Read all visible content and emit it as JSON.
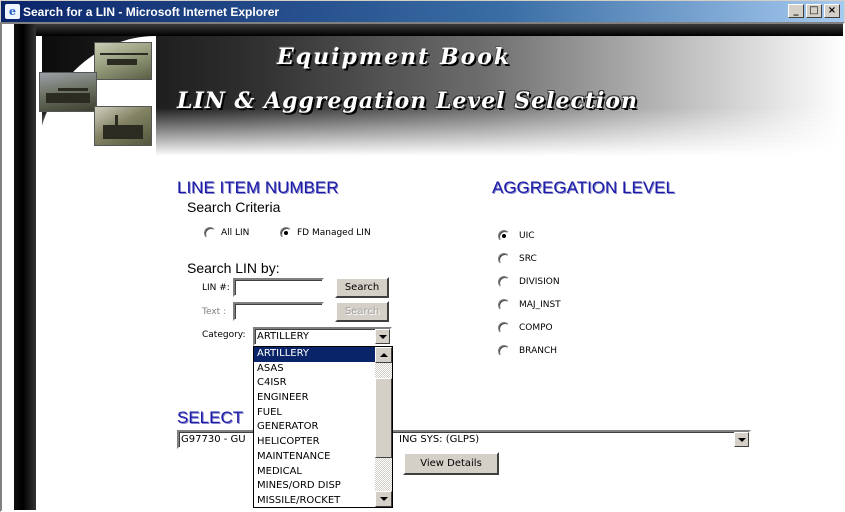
{
  "window": {
    "title": "Search for a LIN - Microsoft Internet Explorer",
    "min_label": "_",
    "max_label": "□",
    "close_label": "×"
  },
  "header": {
    "title": "Equipment Book",
    "subtitle": "LIN & Aggregation Level Selection"
  },
  "lin": {
    "section_title": "LINE ITEM NUMBER",
    "criteria_label": "Search Criteria",
    "criteria_options": [
      {
        "label": "All LIN",
        "selected": false
      },
      {
        "label": "FD Managed LIN",
        "selected": true
      }
    ],
    "search_by_label": "Search LIN by:",
    "lin_label": "LIN #:",
    "lin_value": "",
    "text_label": "Text :",
    "text_value": "",
    "search_button": "Search",
    "search_button_disabled": "Search",
    "category_label": "Category:",
    "category_value": "ARTILLERY",
    "category_options": [
      "ARTILLERY",
      "ASAS",
      "C4ISR",
      "ENGINEER",
      "FUEL",
      "GENERATOR",
      "HELICOPTER",
      "MAINTENANCE",
      "MEDICAL",
      "MINES/ORD DISP",
      "MISSILE/ROCKET"
    ]
  },
  "agg": {
    "section_title": "AGGREGATION LEVEL",
    "options": [
      {
        "label": "UIC",
        "selected": true
      },
      {
        "label": "SRC",
        "selected": false
      },
      {
        "label": "DIVISION",
        "selected": false
      },
      {
        "label": "MAJ_INST",
        "selected": false
      },
      {
        "label": "COMPO",
        "selected": false
      },
      {
        "label": "BRANCH",
        "selected": false
      }
    ]
  },
  "select": {
    "section_title_visible": "SELECT",
    "value_left": "G97730 - GU",
    "value_right": "ING SYS: (GLPS)",
    "view_details_button": "View Details"
  }
}
